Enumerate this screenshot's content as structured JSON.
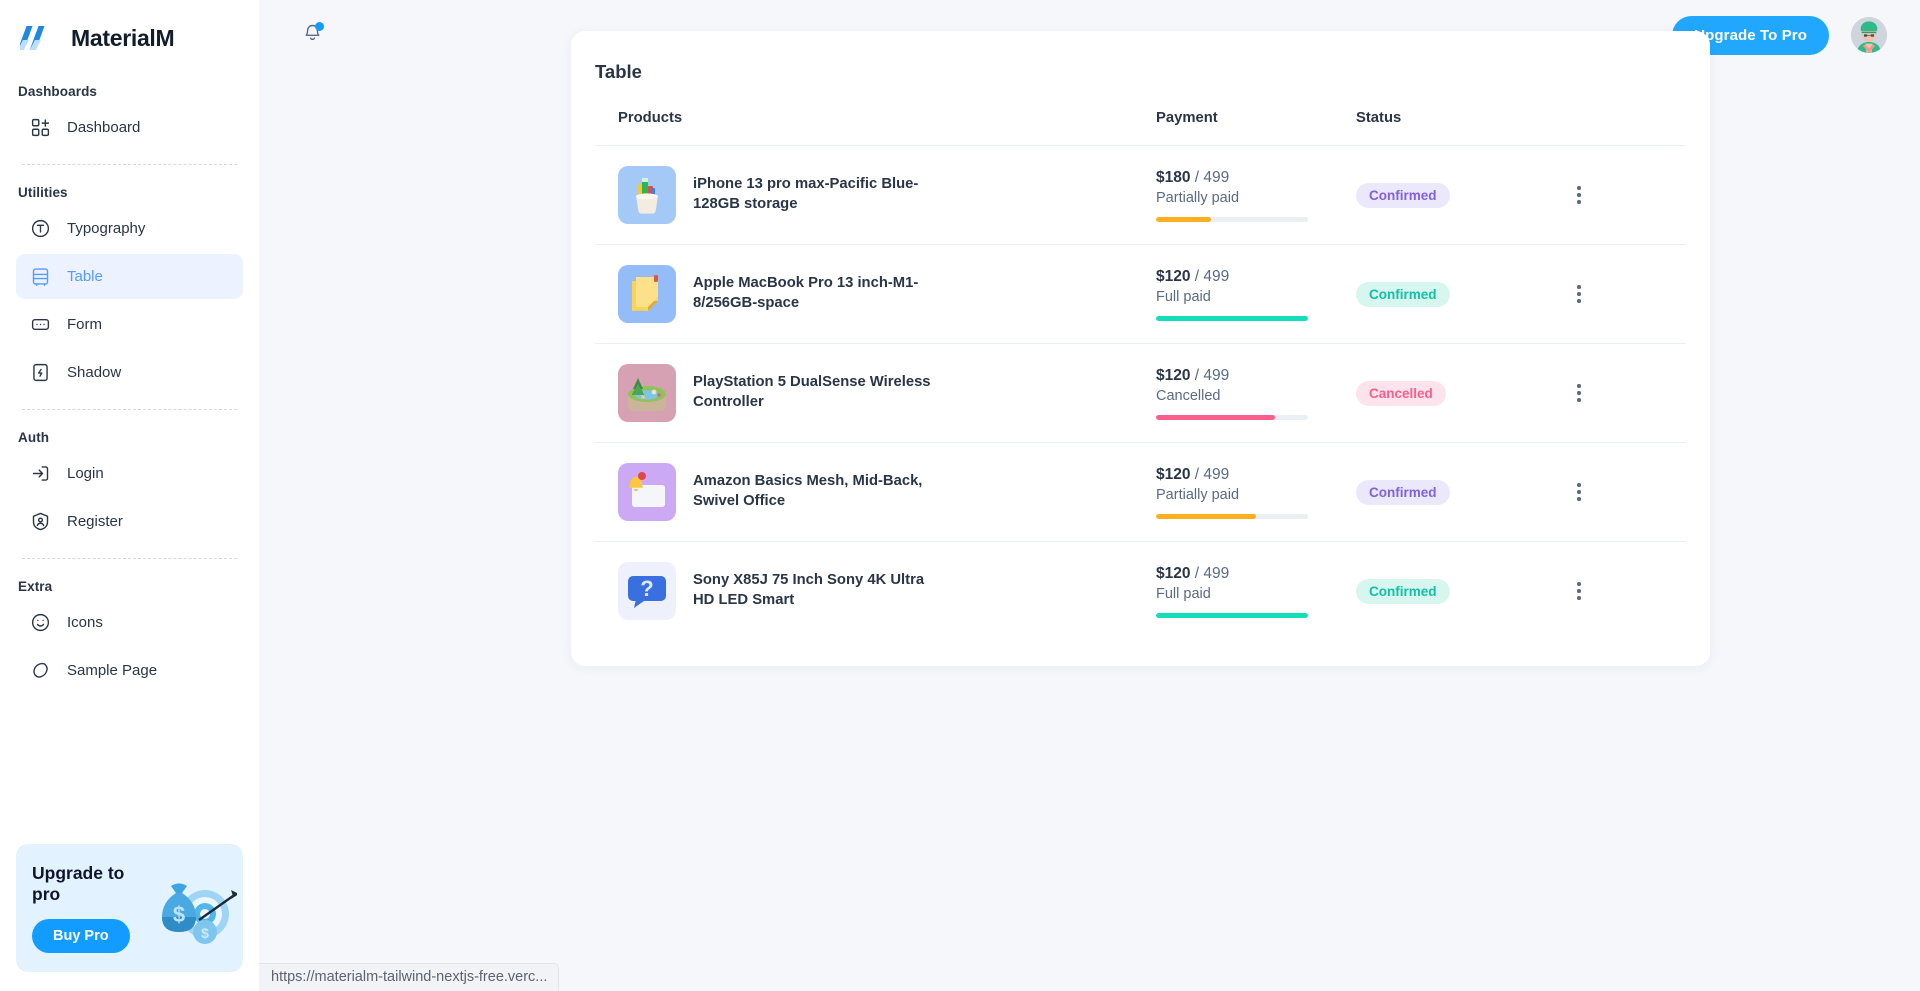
{
  "brand": {
    "name": "MaterialM",
    "logo_icon": "materialm-logo-icon"
  },
  "sidebar": {
    "sections": [
      {
        "caption": "Dashboards",
        "items": [
          {
            "label": "Dashboard",
            "icon": "dashboard-grid-icon",
            "active": false
          }
        ]
      },
      {
        "caption": "Utilities",
        "items": [
          {
            "label": "Typography",
            "icon": "typography-icon",
            "active": false
          },
          {
            "label": "Table",
            "icon": "table-icon",
            "active": true
          },
          {
            "label": "Form",
            "icon": "form-icon",
            "active": false
          },
          {
            "label": "Shadow",
            "icon": "shadow-icon",
            "active": false
          }
        ]
      },
      {
        "caption": "Auth",
        "items": [
          {
            "label": "Login",
            "icon": "login-icon",
            "active": false
          },
          {
            "label": "Register",
            "icon": "register-icon",
            "active": false
          }
        ]
      },
      {
        "caption": "Extra",
        "items": [
          {
            "label": "Icons",
            "icon": "smiley-icon",
            "active": false
          },
          {
            "label": "Sample Page",
            "icon": "sample-page-icon",
            "active": false
          }
        ]
      }
    ],
    "upgrade_card": {
      "title": "Upgrade to pro",
      "button_label": "Buy Pro",
      "art_icon": "money-bag-target-icon"
    }
  },
  "topbar": {
    "notification_icon": "bell-icon",
    "has_notification_dot": true,
    "upgrade_button_label": "Upgrade To Pro",
    "avatar_icon": "user-avatar"
  },
  "main": {
    "card_title": "Table",
    "columns": [
      "Products",
      "Payment",
      "Status",
      ""
    ],
    "rows": [
      {
        "thumb_icon": "pencil-cup-icon",
        "thumb_bg": "#a5c9f7",
        "name": "iPhone 13 pro max-Pacific Blue-128GB storage",
        "amount": "$180",
        "total": "/ 499",
        "payment_status": "Partially paid",
        "progress_color": "#ffae1f",
        "progress_pct": 36,
        "status": "Confirmed",
        "status_bg": "#ece8fb",
        "status_color": "#8063dc",
        "menu_icon": "kebab-menu-icon"
      },
      {
        "thumb_icon": "sticky-note-icon",
        "thumb_bg": "#93bcf8",
        "name": "Apple MacBook Pro 13 inch-M1-8/256GB-space",
        "amount": "$120",
        "total": "/ 499",
        "payment_status": "Full paid",
        "progress_color": "#13deb9",
        "progress_pct": 100,
        "status": "Confirmed",
        "status_bg": "#d7f7ee",
        "status_color": "#13bfa6",
        "menu_icon": "kebab-menu-icon"
      },
      {
        "thumb_icon": "island-game-icon",
        "thumb_bg": "#d5a1b3",
        "name": "PlayStation 5 DualSense Wireless Controller",
        "amount": "$120",
        "total": "/ 499",
        "payment_status": "Cancelled",
        "progress_color": "#fa5f8c",
        "progress_pct": 78,
        "status": "Cancelled",
        "status_bg": "#fde4ec",
        "status_color": "#fa5f8c",
        "menu_icon": "kebab-menu-icon"
      },
      {
        "thumb_icon": "notification-card-icon",
        "thumb_bg": "#cba9f5",
        "name": "Amazon Basics Mesh, Mid-Back, Swivel Office",
        "amount": "$120",
        "total": "/ 499",
        "payment_status": "Partially paid",
        "progress_color": "#ffae1f",
        "progress_pct": 66,
        "status": "Confirmed",
        "status_bg": "#ece8fb",
        "status_color": "#8063dc",
        "menu_icon": "kebab-menu-icon"
      },
      {
        "thumb_icon": "question-bubble-icon",
        "thumb_bg": "#eef1fb",
        "name": "Sony X85J 75 Inch Sony 4K Ultra HD LED Smart",
        "amount": "$120",
        "total": "/ 499",
        "payment_status": "Full paid",
        "progress_color": "#13deb9",
        "progress_pct": 100,
        "status": "Confirmed",
        "status_bg": "#d7f7ee",
        "status_color": "#13bfa6",
        "menu_icon": "kebab-menu-icon"
      }
    ]
  },
  "statusbar": {
    "url": "https://materialm-tailwind-nextjs-free.verc..."
  }
}
